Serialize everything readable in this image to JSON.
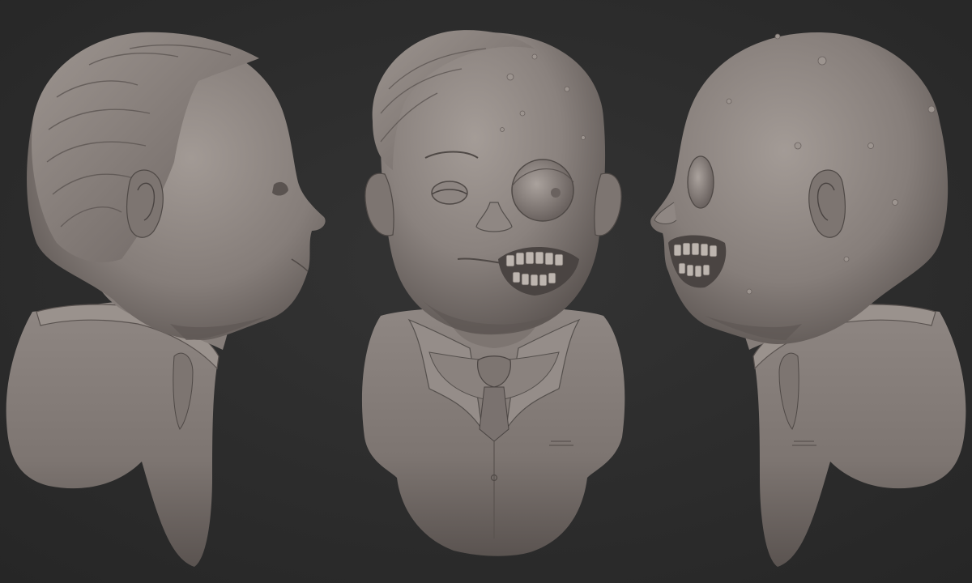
{
  "scene": {
    "subject": "",
    "views": [
      {
        "id": "left-profile"
      },
      {
        "id": "front"
      },
      {
        "id": "right-profile"
      }
    ]
  },
  "palette": {
    "background": "#303030",
    "background_vignette": "#262626",
    "clay_light": "#a29a95",
    "clay_mid": "#857d79",
    "clay_dark": "#5a5350",
    "clay_shadow": "#3f3a38",
    "teeth": "#bdb5af"
  }
}
